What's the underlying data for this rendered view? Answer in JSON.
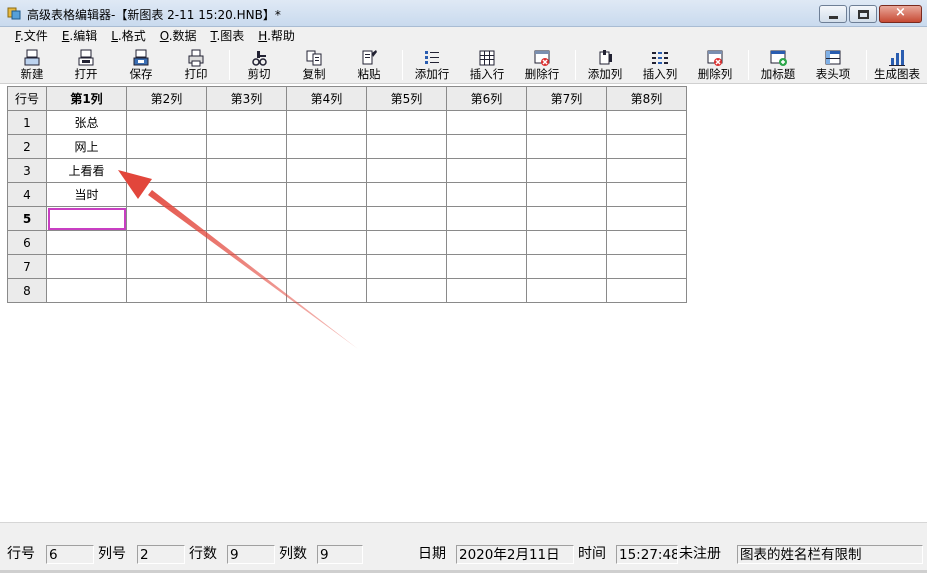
{
  "window": {
    "title": "高级表格编辑器-【新图表 2-11 15:20.HNB】*",
    "minimize": "minimize",
    "maximize": "maximize",
    "close": "×"
  },
  "menu": [
    {
      "acc": "F",
      "label": ".文件"
    },
    {
      "acc": "E",
      "label": ".编辑"
    },
    {
      "acc": "L",
      "label": ".格式"
    },
    {
      "acc": "O",
      "label": ".数据"
    },
    {
      "acc": "T",
      "label": ".图表"
    },
    {
      "acc": "H",
      "label": ".帮助"
    }
  ],
  "toolbar": {
    "new": "新建",
    "open": "打开",
    "save": "保存",
    "print": "打印",
    "cut": "剪切",
    "copy": "复制",
    "paste": "粘贴",
    "add_row": "添加行",
    "insert_row": "插入行",
    "delete_row": "删除行",
    "add_col": "添加列",
    "insert_col": "插入列",
    "delete_col": "删除列",
    "add_title": "加标题",
    "header_item": "表头项",
    "gen_chart": "生成图表"
  },
  "grid": {
    "corner": "行号",
    "columns": [
      "第1列",
      "第2列",
      "第3列",
      "第4列",
      "第5列",
      "第6列",
      "第7列",
      "第8列"
    ],
    "rows": [
      {
        "num": "1",
        "cells": [
          "张总",
          "",
          "",
          "",
          "",
          "",
          "",
          ""
        ]
      },
      {
        "num": "2",
        "cells": [
          "网上",
          "",
          "",
          "",
          "",
          "",
          "",
          ""
        ]
      },
      {
        "num": "3",
        "cells": [
          "上看看",
          "",
          "",
          "",
          "",
          "",
          "",
          ""
        ]
      },
      {
        "num": "4",
        "cells": [
          "当时",
          "",
          "",
          "",
          "",
          "",
          "",
          ""
        ]
      },
      {
        "num": "5",
        "cells": [
          "",
          "",
          "",
          "",
          "",
          "",
          "",
          ""
        ]
      },
      {
        "num": "6",
        "cells": [
          "",
          "",
          "",
          "",
          "",
          "",
          "",
          ""
        ]
      },
      {
        "num": "7",
        "cells": [
          "",
          "",
          "",
          "",
          "",
          "",
          "",
          ""
        ]
      },
      {
        "num": "8",
        "cells": [
          "",
          "",
          "",
          "",
          "",
          "",
          "",
          ""
        ]
      }
    ],
    "active_row": 5,
    "active_col": 1
  },
  "status": {
    "row_label": "行号",
    "row_value": "6",
    "col_label": "列号",
    "col_value": "2",
    "rows_label": "行数",
    "rows_value": "9",
    "cols_label": "列数",
    "cols_value": "9",
    "date_label": "日期",
    "date_value": "2020年2月11日",
    "time_label": "时间",
    "time_value": "15:27:48",
    "reg_status": "未注册",
    "hint": "图表的姓名栏有限制"
  },
  "colors": {
    "active_cell_border": "#c83fc2",
    "annotation_arrow": "#e2463b"
  }
}
